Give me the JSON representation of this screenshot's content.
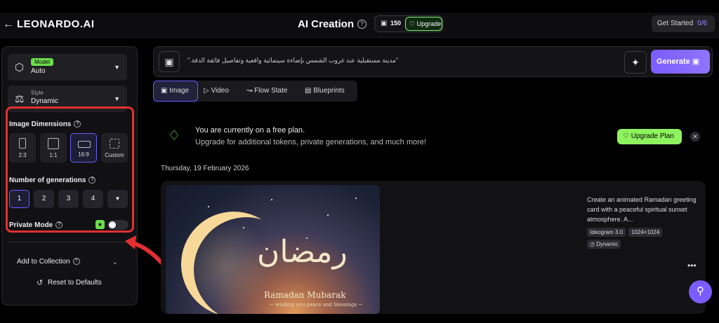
{
  "header": {
    "logo": "LEONARDO.AI",
    "title": "AI Creation",
    "token_count": "150",
    "upgrade_label": "Upgrade",
    "get_started": "Get Started",
    "get_started_progress": "0/6"
  },
  "sidebar": {
    "model_badge": "Model",
    "model_value": "Auto",
    "style_label": "Style",
    "style_value": "Dynamic",
    "dimensions_label": "Image Dimensions",
    "dimensions": [
      "2:3",
      "1:1",
      "16:9",
      "Custom"
    ],
    "selected_dimension": "16:9",
    "generations_label": "Number of generations",
    "generations": [
      "1",
      "2",
      "3",
      "4"
    ],
    "selected_generation": "1",
    "private_mode_label": "Private Mode",
    "private_mode_on": false,
    "add_to_collection": "Add to Collection",
    "reset": "Reset to Defaults"
  },
  "prompt": {
    "text": "\"مدينة مستقبلية عند غروب الشمس بإضاءة سينمائية واقعية وتفاصيل فائقة الدقة.\"",
    "generate_label": "Generate"
  },
  "tabs": [
    "Image",
    "Video",
    "Flow State",
    "Blueprints"
  ],
  "active_tab": "Image",
  "plan_notice": {
    "line1": "You are currently on a free plan.",
    "line2": "Upgrade for additional tokens, private generations, and much more!",
    "button": "Upgrade Plan"
  },
  "date": "Thursday, 19 February 2026",
  "generation": {
    "image_text_main": "Ramadan Mubarak",
    "image_text_sub": "~ wishing you peace and blessings ~",
    "image_calligraphy": "رمضان",
    "description": "Create an animated Ramadan greeting card with a peaceful spiritual sunset atmosphere. A...",
    "model_tag": "Ideogram 3.0",
    "size_tag": "1024×1024",
    "style_tag": "Dynamic"
  },
  "colors": {
    "accent": "#7b5cff",
    "green": "#7ef26a",
    "annotation_red": "#e23030"
  }
}
